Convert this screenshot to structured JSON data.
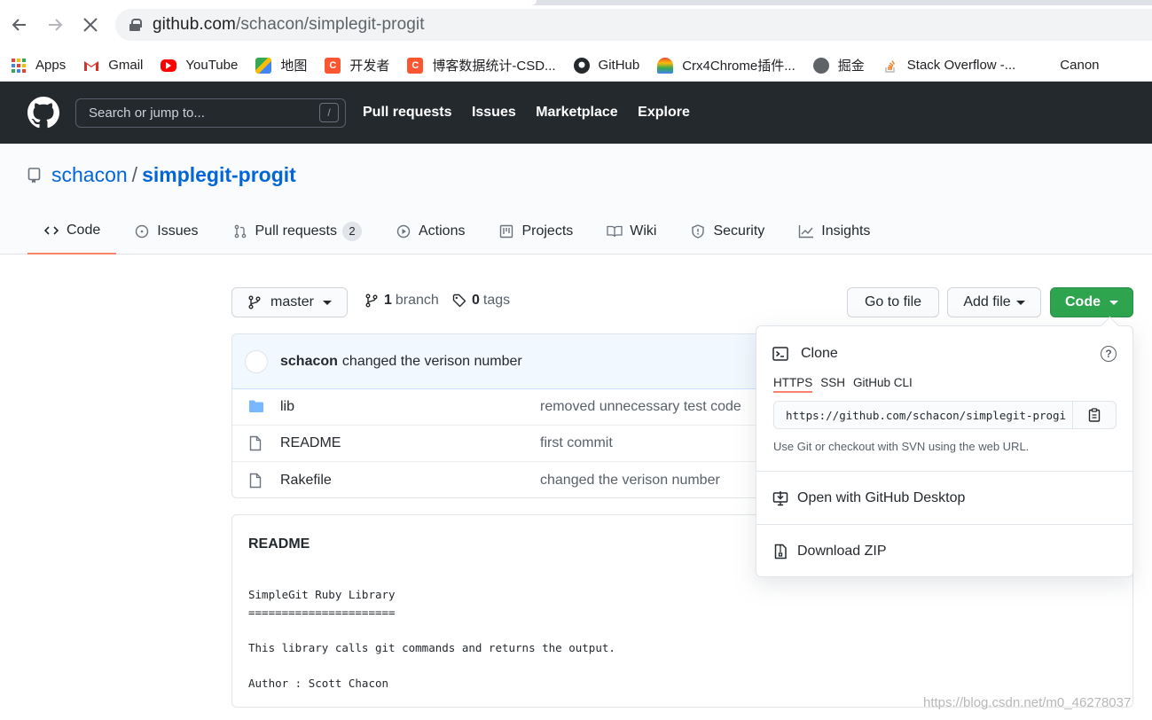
{
  "browser": {
    "url_host": "github.com",
    "url_path": "/schacon/simplegit-progit",
    "bookmarks": [
      {
        "label": "Apps",
        "icon": "apps-grid-icon",
        "color": "#ea4335"
      },
      {
        "label": "Gmail",
        "icon": "gmail-icon",
        "color": "#d93025"
      },
      {
        "label": "YouTube",
        "icon": "youtube-icon",
        "color": "#ff0000"
      },
      {
        "label": "地图",
        "icon": "maps-icon",
        "color": "#34a853"
      },
      {
        "label": "开发者",
        "icon": "csdn-icon",
        "color": "#fc5531"
      },
      {
        "label": "博客数据统计-CSD...",
        "icon": "csdn-icon",
        "color": "#fc5531"
      },
      {
        "label": "GitHub",
        "icon": "github-icon",
        "color": "#24292e"
      },
      {
        "label": "Crx4Chrome插件...",
        "icon": "rainbow-icon",
        "color": "#f4b400"
      },
      {
        "label": "掘金",
        "icon": "globe-icon",
        "color": "#5f6368"
      },
      {
        "label": "Stack Overflow -...",
        "icon": "stackoverflow-icon",
        "color": "#f48024"
      },
      {
        "label": "Canon",
        "icon": "canon-icon",
        "color": "#cc0000"
      }
    ]
  },
  "header": {
    "search_placeholder": "Search or jump to...",
    "search_shortcut": "/",
    "nav": [
      "Pull requests",
      "Issues",
      "Marketplace",
      "Explore"
    ]
  },
  "repo": {
    "owner": "schacon",
    "separator": "/",
    "name": "simplegit-progit",
    "tabs": [
      {
        "label": "Code",
        "icon": "code-icon"
      },
      {
        "label": "Issues",
        "icon": "issue-icon"
      },
      {
        "label": "Pull requests",
        "icon": "pull-request-icon",
        "count": "2"
      },
      {
        "label": "Actions",
        "icon": "play-icon"
      },
      {
        "label": "Projects",
        "icon": "project-icon"
      },
      {
        "label": "Wiki",
        "icon": "book-icon"
      },
      {
        "label": "Security",
        "icon": "shield-icon"
      },
      {
        "label": "Insights",
        "icon": "graph-icon"
      }
    ]
  },
  "filenav": {
    "branch": "master",
    "branch_count": "1",
    "branch_label": "branch",
    "tag_count": "0",
    "tag_label": "tags",
    "goto_file": "Go to file",
    "add_file": "Add file",
    "code": "Code"
  },
  "commit": {
    "author": "schacon",
    "message": "changed the verison number"
  },
  "files": [
    {
      "name": "lib",
      "type": "folder",
      "message": "removed unnecessary test code"
    },
    {
      "name": "README",
      "type": "file",
      "message": "first commit"
    },
    {
      "name": "Rakefile",
      "type": "file",
      "message": "changed the verison number"
    }
  ],
  "readme": {
    "title": "README",
    "content": "SimpleGit Ruby Library\n======================\n\nThis library calls git commands and returns the output.\n\nAuthor : Scott Chacon"
  },
  "clone": {
    "title": "Clone",
    "protocols": [
      "HTTPS",
      "SSH",
      "GitHub CLI"
    ],
    "url": "https://github.com/schacon/simplegit-progit.git",
    "hint": "Use Git or checkout with SVN using the web URL.",
    "open_desktop": "Open with GitHub Desktop",
    "download_zip": "Download ZIP"
  },
  "watermark": "https://blog.csdn.net/m0_46278037",
  "colors": {
    "header_bg": "#24292e",
    "link": "#0366d6",
    "primary_green": "#2ea44f",
    "active_tab_underline": "#f9826c",
    "folder": "#79b8ff"
  }
}
